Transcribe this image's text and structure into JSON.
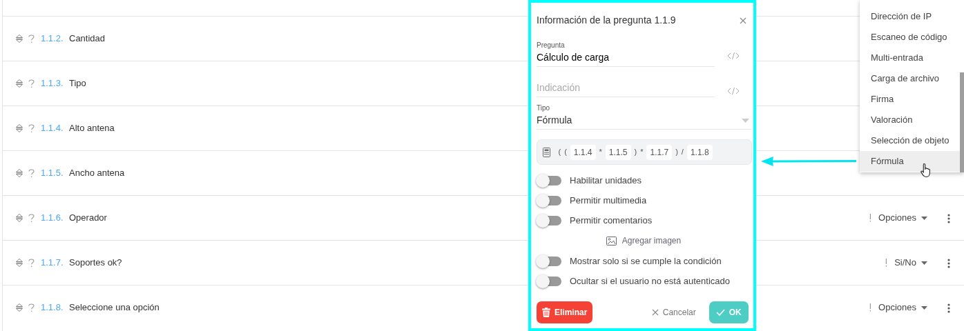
{
  "questions": [
    {
      "number": "1.1.2.",
      "title": "Cantidad"
    },
    {
      "number": "1.1.3.",
      "title": "Tipo"
    },
    {
      "number": "1.1.4.",
      "title": "Alto antena"
    },
    {
      "number": "1.1.5.",
      "title": "Ancho antena"
    },
    {
      "number": "1.1.6.",
      "title": "Operador",
      "type": "Opciones"
    },
    {
      "number": "1.1.7.",
      "title": "Soportes ok?",
      "type": "Si/No"
    },
    {
      "number": "1.1.8.",
      "title": "Seleccione una opción",
      "type": "Opciones"
    }
  ],
  "dialog": {
    "title": "Información de la pregunta 1.1.9",
    "question": {
      "label": "Pregunta",
      "value": "Cálculo de carga"
    },
    "hint": {
      "placeholder": "Indicación"
    },
    "type": {
      "label": "Tipo",
      "value": "Fórmula"
    },
    "formula": [
      {
        "kind": "op",
        "text": "("
      },
      {
        "kind": "op",
        "text": "("
      },
      {
        "kind": "ref",
        "text": "1.1.4"
      },
      {
        "kind": "op",
        "text": "*"
      },
      {
        "kind": "ref",
        "text": "1.1.5"
      },
      {
        "kind": "op",
        "text": ")"
      },
      {
        "kind": "op",
        "text": "*"
      },
      {
        "kind": "ref",
        "text": "1.1.7"
      },
      {
        "kind": "op",
        "text": ")"
      },
      {
        "kind": "op",
        "text": "/"
      },
      {
        "kind": "ref",
        "text": "1.1.8"
      }
    ],
    "settings": [
      {
        "kind": "toggle",
        "label": "Habilitar unidades",
        "on": false
      },
      {
        "kind": "toggle",
        "label": "Permitir multimedia",
        "on": false
      },
      {
        "kind": "toggle",
        "label": "Permitir comentarios",
        "on": false
      },
      {
        "kind": "action",
        "label": "Agregar imagen"
      },
      {
        "kind": "toggle",
        "label": "Mostrar solo si se cumple la condición",
        "on": false
      },
      {
        "kind": "toggle",
        "label": "Ocultar si el usuario no está autenticado",
        "on": false
      }
    ],
    "buttons": {
      "delete": "Eliminar",
      "cancel": "Cancelar",
      "ok": "OK"
    }
  },
  "type_menu": {
    "items": [
      {
        "label": "Dirección de IP",
        "selected": false
      },
      {
        "label": "Escaneo de código",
        "selected": false
      },
      {
        "label": "Multi-entrada",
        "selected": false
      },
      {
        "label": "Carga de archivo",
        "selected": false
      },
      {
        "label": "Firma",
        "selected": false
      },
      {
        "label": "Valoración",
        "selected": false
      },
      {
        "label": "Selección de objeto",
        "selected": false
      },
      {
        "label": "Fórmula",
        "selected": true
      }
    ]
  }
}
